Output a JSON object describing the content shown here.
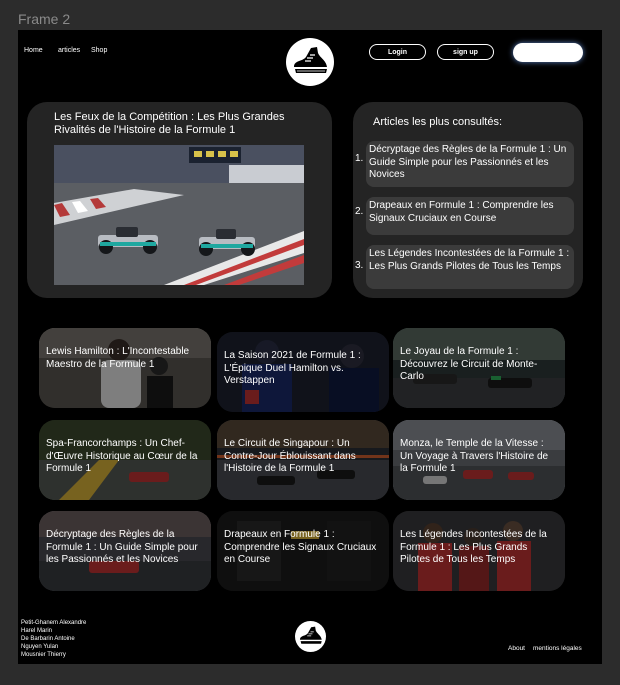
{
  "frame": {
    "label": "Frame 2"
  },
  "nav": {
    "home": "Home",
    "articles": "articles",
    "shop": "Shop"
  },
  "auth": {
    "login": "Login",
    "signup": "sign up"
  },
  "search": {
    "placeholder": ""
  },
  "featured": {
    "title": "Les Feux de la Compétition : Les Plus Grandes Rivalités de l'Histoire de la Formule 1"
  },
  "popular": {
    "title": "Articles les plus consultés:",
    "items": [
      {
        "num": "1.",
        "text": "Décryptage des Règles de la Formule 1 : Un Guide Simple pour les Passionnés et les Novices"
      },
      {
        "num": "2.",
        "text": "Drapeaux en Formule 1 : Comprendre les Signaux Cruciaux en Course"
      },
      {
        "num": "3.",
        "text": "Les Légendes Incontestées de la Formule 1 : Les Plus Grands Pilotes de Tous les Temps"
      }
    ]
  },
  "articles": [
    {
      "title": "Lewis Hamilton : L'Incontestable Maestro de la Formule 1"
    },
    {
      "title": "La Saison 2021 de Formule 1 : L'Épique Duel Hamilton vs. Verstappen"
    },
    {
      "title": "Le Joyau de la Formule 1 : Découvrez le Circuit de Monte-Carlo"
    },
    {
      "title": "Spa-Francorchamps : Un Chef-d'Œuvre Historique au Cœur de la Formule 1"
    },
    {
      "title": "Le Circuit de Singapour : Un Contre-Jour Éblouissant dans l'Histoire de la Formule 1"
    },
    {
      "title": "Monza, le Temple de la Vitesse : Un Voyage à Travers l'Histoire de la Formule 1"
    },
    {
      "title": "Décryptage des Règles de la Formule 1 : Un Guide Simple pour les Passionnés et les Novices"
    },
    {
      "title": "Drapeaux en Formule 1 : Comprendre les Signaux Cruciaux en Course"
    },
    {
      "title": "Les Légendes Incontestées de la Formule 1 : Les Plus Grands Pilotes de Tous les Temps"
    }
  ],
  "footer": {
    "credits": [
      "Petit-Ghanem Alexandre",
      "Harel Marin",
      "De Barbarin Antoine",
      "Nguyen Yulan",
      "Mousnier Thierry"
    ],
    "about": "About",
    "legal": "mentions légales"
  }
}
